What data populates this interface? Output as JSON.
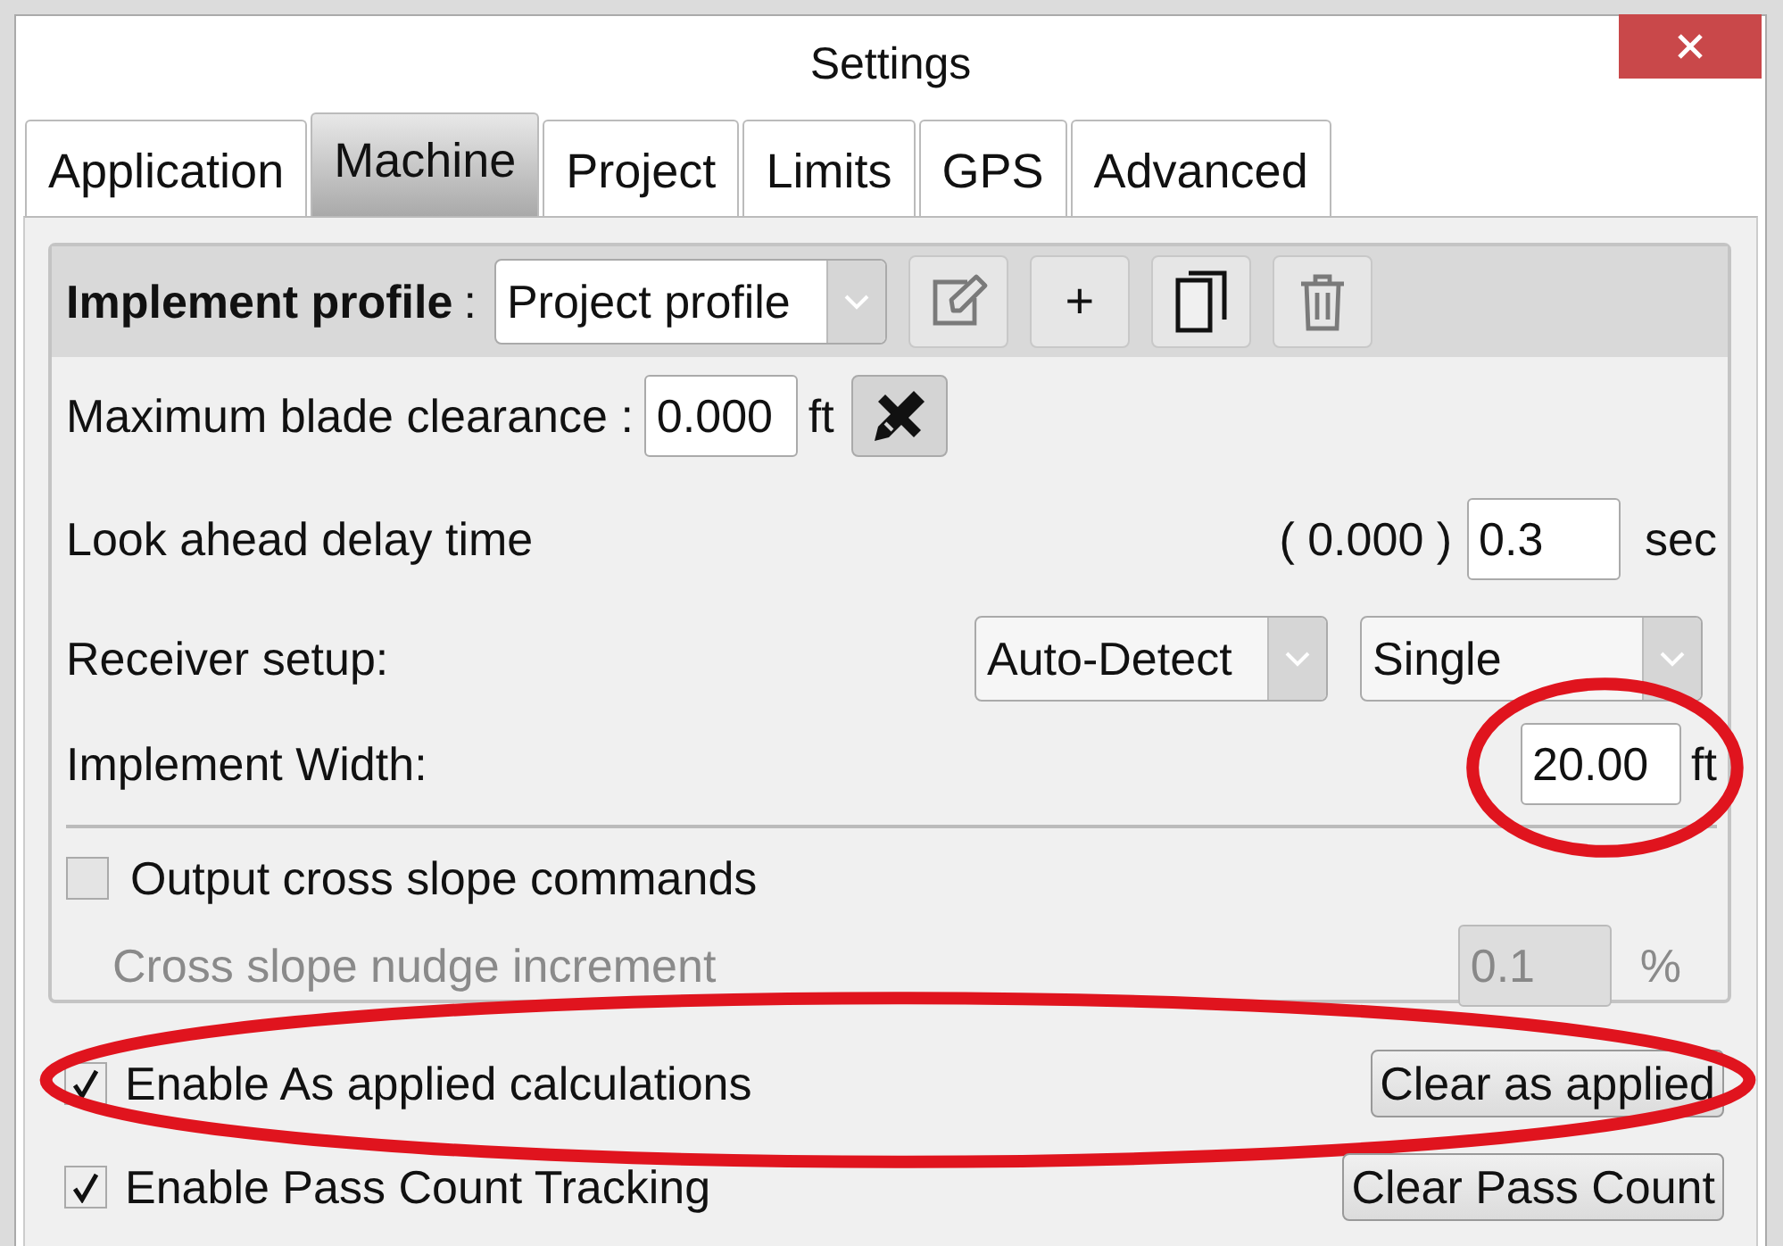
{
  "window": {
    "title": "Settings"
  },
  "tabs": [
    {
      "label": "Application",
      "selected": false
    },
    {
      "label": "Machine",
      "selected": true
    },
    {
      "label": "Project",
      "selected": false
    },
    {
      "label": "Limits",
      "selected": false
    },
    {
      "label": "GPS",
      "selected": false
    },
    {
      "label": "Advanced",
      "selected": false
    }
  ],
  "profile": {
    "label": "Implement profile",
    "separator": ":",
    "value": "Project profile",
    "buttons": [
      {
        "kind": "edit",
        "disabled": true
      },
      {
        "kind": "add",
        "text": "+",
        "disabled": false
      },
      {
        "kind": "copy",
        "disabled": false
      },
      {
        "kind": "delete",
        "disabled": true
      }
    ]
  },
  "blade_clearance": {
    "label": "Maximum blade clearance :",
    "value": "0.000",
    "unit": "ft"
  },
  "look_ahead": {
    "label": "Look ahead delay time",
    "reading": "( 0.000 )",
    "value": "0.3",
    "unit": "sec"
  },
  "receiver": {
    "label": "Receiver setup:",
    "dropdowns": [
      "Auto-Detect",
      "Single"
    ]
  },
  "implement_width": {
    "label": "Implement Width:",
    "value": "20.00",
    "unit": "ft",
    "highlighted": true
  },
  "cross_slope": {
    "label": "Output cross slope commands",
    "checked": false
  },
  "nudge": {
    "label": "Cross slope nudge increment",
    "value": "0.1",
    "unit": "%",
    "disabled": true
  },
  "options": [
    {
      "label": "Enable As applied calculations",
      "checked": true,
      "button": "Clear as applied",
      "highlighted": true
    },
    {
      "label": "Enable Pass Count Tracking",
      "checked": true,
      "button": "Clear Pass Count"
    }
  ]
}
